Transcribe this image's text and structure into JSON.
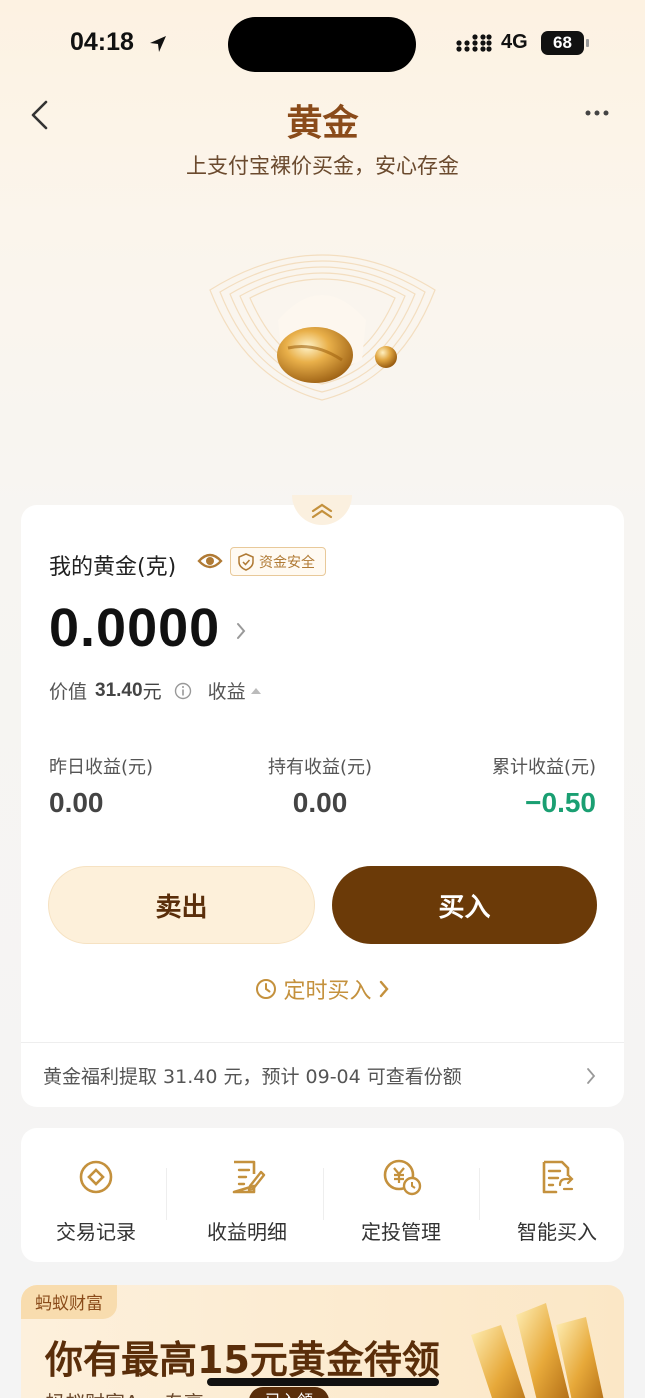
{
  "status_bar": {
    "time": "04:18",
    "network": "4G",
    "battery": "68"
  },
  "nav": {
    "title": "黄金",
    "subtitle": "上支付宝裸价买金，安心存金"
  },
  "holding": {
    "label": "我的黄金(克)",
    "safe_badge": "资金安全",
    "amount": "0.0000",
    "value_label": "价值",
    "value_amount": "31.40",
    "value_unit": "元",
    "profit_toggle": "收益"
  },
  "stats": [
    {
      "label": "昨日收益(元)",
      "value": "0.00"
    },
    {
      "label": "持有收益(元)",
      "value": "0.00"
    },
    {
      "label": "累计收益(元)",
      "value": "−0.50"
    }
  ],
  "actions": {
    "sell": "卖出",
    "buy": "买入",
    "timed_buy": "定时买入"
  },
  "notice": "黄金福利提取 31.40 元，预计 09-04 可查看份额",
  "shortcuts": [
    {
      "label": "交易记录",
      "icon": "coin-record-icon"
    },
    {
      "label": "收益明细",
      "icon": "edit-document-icon"
    },
    {
      "label": "定投管理",
      "icon": "yuan-clock-icon"
    },
    {
      "label": "智能买入",
      "icon": "document-refresh-icon"
    }
  ],
  "promo": {
    "tag": "蚂蚁财富",
    "title": "你有最高15元黄金待领",
    "subtitle": "蚂蚁财富A... 专享",
    "chip": "已入领"
  },
  "colors": {
    "brand_brown": "#6b3a08",
    "gold": "#c4913d",
    "loss_green": "#1a9f72"
  }
}
